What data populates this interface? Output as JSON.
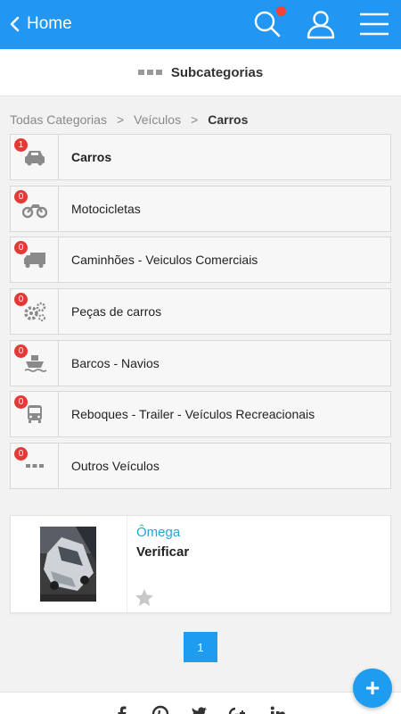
{
  "topbar": {
    "back_label": "Home",
    "icons": [
      "search-icon",
      "user-icon",
      "menu-icon"
    ],
    "accent_color": "#2196f3",
    "notification_color": "#f44336"
  },
  "subheader": {
    "title": "Subcategorias"
  },
  "breadcrumb": {
    "items": [
      "Todas Categorias",
      "Veículos"
    ],
    "current": "Carros",
    "separator": ">"
  },
  "categories": [
    {
      "label": "Carros",
      "count": "1",
      "icon": "car-icon",
      "active": true
    },
    {
      "label": "Motocicletas",
      "count": "0",
      "icon": "motorcycle-icon",
      "active": false
    },
    {
      "label": "Caminhões - Veiculos Comerciais",
      "count": "0",
      "icon": "truck-icon",
      "active": false
    },
    {
      "label": "Peças de carros",
      "count": "0",
      "icon": "gears-icon",
      "active": false
    },
    {
      "label": "Barcos - Navios",
      "count": "0",
      "icon": "ship-icon",
      "active": false
    },
    {
      "label": "Reboques - Trailer - Veículos Recreacionais",
      "count": "0",
      "icon": "bus-icon",
      "active": false
    },
    {
      "label": "Outros Veículos",
      "count": "0",
      "icon": "more-dots-icon",
      "active": false
    }
  ],
  "listing": {
    "title": "Ômega",
    "action": "Verificar",
    "image": "car-photo",
    "favorite_icon": "star-icon"
  },
  "pagination": {
    "current_page": "1"
  },
  "footer": {
    "icons": [
      "facebook-icon",
      "pinterest-icon",
      "twitter-icon",
      "google-plus-icon",
      "linkedin-icon"
    ]
  },
  "fab": {
    "label": "+"
  }
}
